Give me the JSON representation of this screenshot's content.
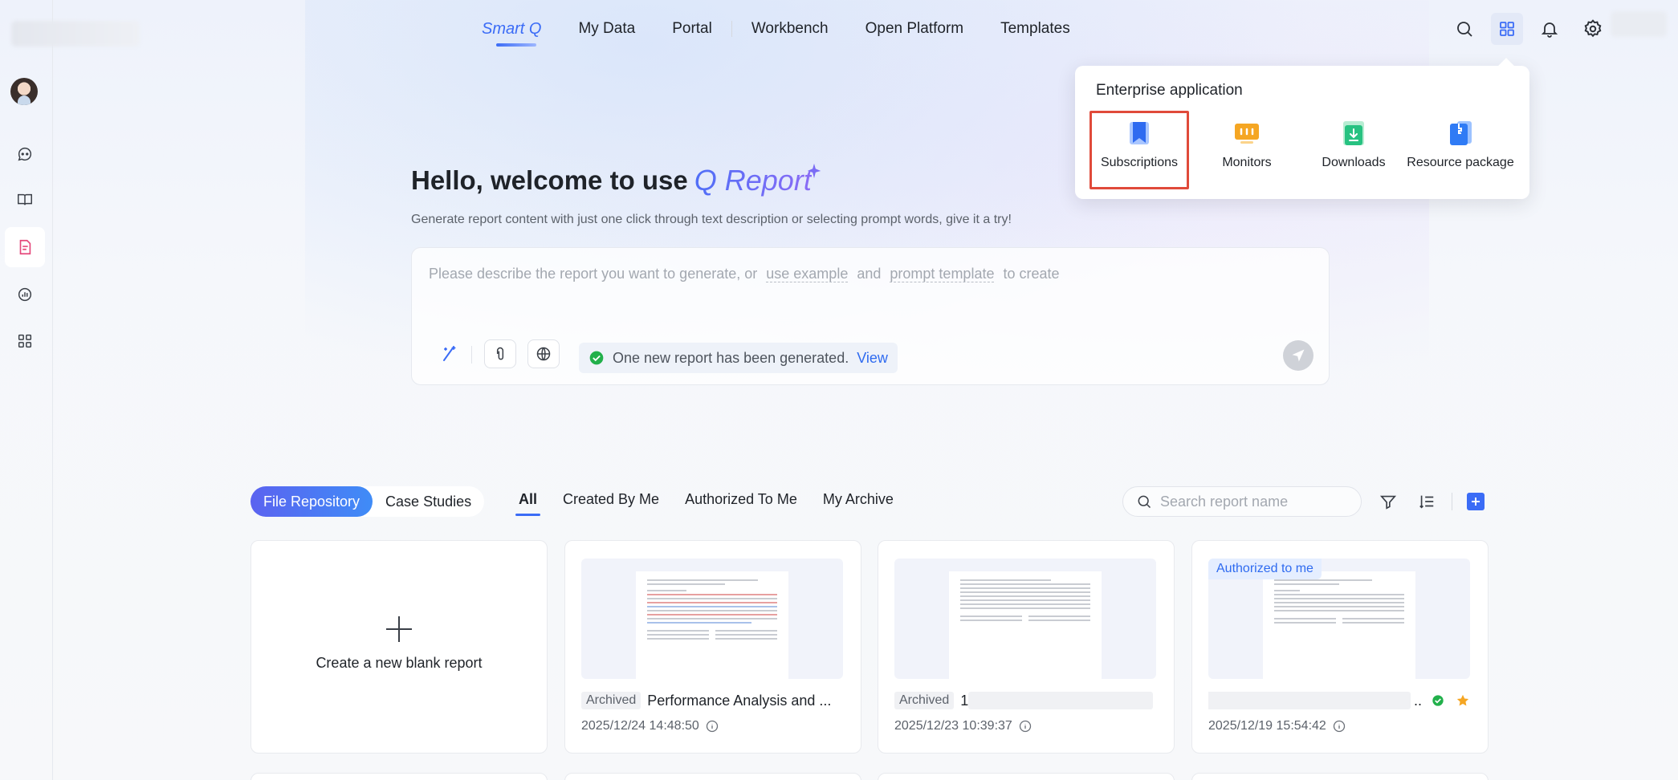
{
  "nav": {
    "brand": "Smart Q",
    "items": [
      "My Data",
      "Portal",
      "Workbench",
      "Open Platform",
      "Templates"
    ]
  },
  "popover": {
    "title": "Enterprise application",
    "apps": [
      {
        "label": "Subscriptions",
        "icon": "bookmark-icon",
        "selected": true
      },
      {
        "label": "Monitors",
        "icon": "monitor-icon"
      },
      {
        "label": "Downloads",
        "icon": "download-icon"
      },
      {
        "label": "Resource package",
        "icon": "package-icon"
      }
    ]
  },
  "hero": {
    "title": "Hello, welcome to use",
    "brand": "Q Report",
    "subtitle": "Generate report content with just one click through text description or selecting prompt words, give it a try!"
  },
  "prompt": {
    "placeholder_start": "Please describe the report you want to generate, or",
    "use_example": "use example",
    "and": "and",
    "prompt_template": "prompt template",
    "to_create": "to create",
    "notice": "One new report has been generated.",
    "notice_link": "View"
  },
  "library": {
    "segments": [
      "File Repository",
      "Case Studies"
    ],
    "active_segment": "File Repository",
    "tabs": [
      "All",
      "Created By Me",
      "Authorized To Me",
      "My Archive"
    ],
    "active_tab": "All",
    "search_placeholder": "Search report name"
  },
  "cards": {
    "new_label": "Create a new blank report",
    "items": [
      {
        "tag": "Archived",
        "title": "Performance Analysis and ...",
        "date": "2025/12/24 14:48:50"
      },
      {
        "tag": "Archived",
        "title": "1",
        "date": "2025/12/23 10:39:37"
      },
      {
        "badge": "Authorized to me",
        "title": "..",
        "date": "2025/12/19 15:54:42"
      }
    ]
  },
  "colors": {
    "accent": "#3b6cf6",
    "highlight_border": "#e04a3a",
    "success": "#22b04b",
    "star": "#f5a623"
  }
}
